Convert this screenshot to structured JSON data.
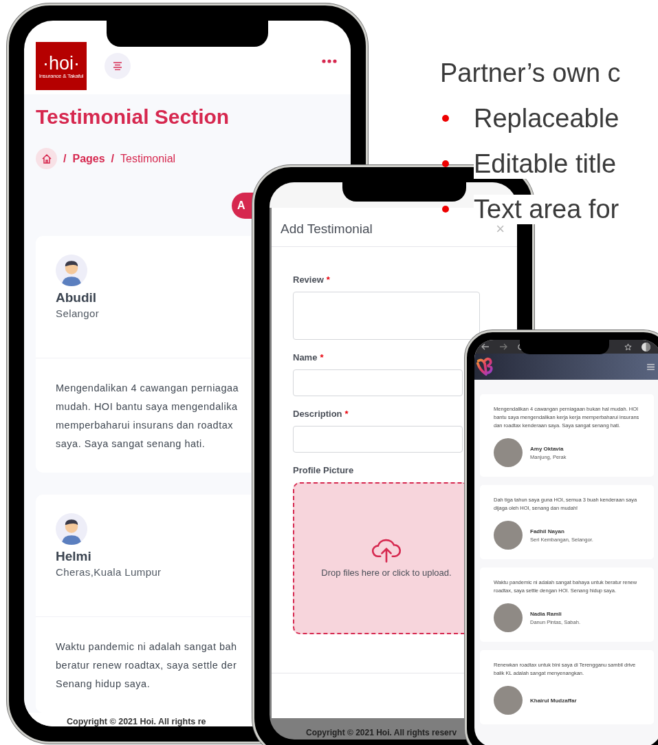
{
  "slide": {
    "heading": "Partner’s own c",
    "bullets": [
      "Replaceable",
      "Editable title",
      "Text area for"
    ]
  },
  "admin_phone": {
    "logo": {
      "wordmark": "·hoi·",
      "tagline": "Insurance & Takaful"
    },
    "page_title": "Testimonial Section",
    "breadcrumb": [
      {
        "kind": "separator",
        "label": "/"
      },
      {
        "kind": "link",
        "label": "Pages"
      },
      {
        "kind": "separator",
        "label": "/"
      },
      {
        "kind": "current",
        "label": "Testimonial"
      }
    ],
    "add_button": "A",
    "testimonials": [
      {
        "name": "Abudil",
        "location": "Selangor",
        "review_lines": [
          "Mengendalikan 4 cawangan perniagaa",
          "mudah. HOI bantu saya mengendalika",
          "memperbaharui insurans dan roadtax",
          "saya. Saya sangat senang hati."
        ]
      },
      {
        "name": "Helmi",
        "location": "Cheras,Kuala Lumpur",
        "review_lines": [
          "Waktu pandemic ni adalah sangat bah",
          "beratur renew roadtax, saya settle der",
          "Senang hidup saya."
        ]
      }
    ],
    "footer": "Copyright © 2021 Hoi. All rights re"
  },
  "form_phone": {
    "modal_title": "Add Testimonial",
    "close": "×",
    "fields": [
      {
        "kind": "textarea",
        "label": "Review",
        "required_mark": "*"
      },
      {
        "kind": "input",
        "label": "Name",
        "required_mark": "*"
      },
      {
        "kind": "input",
        "label": "Description",
        "required_mark": "*"
      },
      {
        "kind": "dropzone",
        "label": "Profile Picture",
        "hint": "Drop files here or click to upload."
      }
    ],
    "footer": "Copyright © 2021 Hoi. All rights reserv"
  },
  "site_phone": {
    "testimonials": [
      {
        "text": "Mengendalikan 4 cawangan perniagaan bukan hal mudah. HOI bantu saya mengendalikan kerja kerja memperbaharui insurans dan roadtax kenderaan saya. Saya sangat senang hati.",
        "name": "Amy Oktavia",
        "location": "Manjung, Perak"
      },
      {
        "text": "Dah tiga tahun saya guna HOI, semua 3 buah kenderaan saya dijaga oleh HOI, senang dan mudah!",
        "name": "Fadhil Nayan",
        "location": "Seri Kembangan, Selangor."
      },
      {
        "text": "Waktu pandemic ni adalah sangat bahaya untuk beratur renew roadtax, saya settle dengan HOI. Senang hidup saya.",
        "name": "Nadia Ramli",
        "location": "Danun Pintas, Sabah."
      },
      {
        "text": "Renewkan roadtax untuk bini saya di Terengganu sambil drive balik KL adalah sangat menyenangkan.",
        "name": "Khairul Mudzaffar"
      }
    ]
  }
}
